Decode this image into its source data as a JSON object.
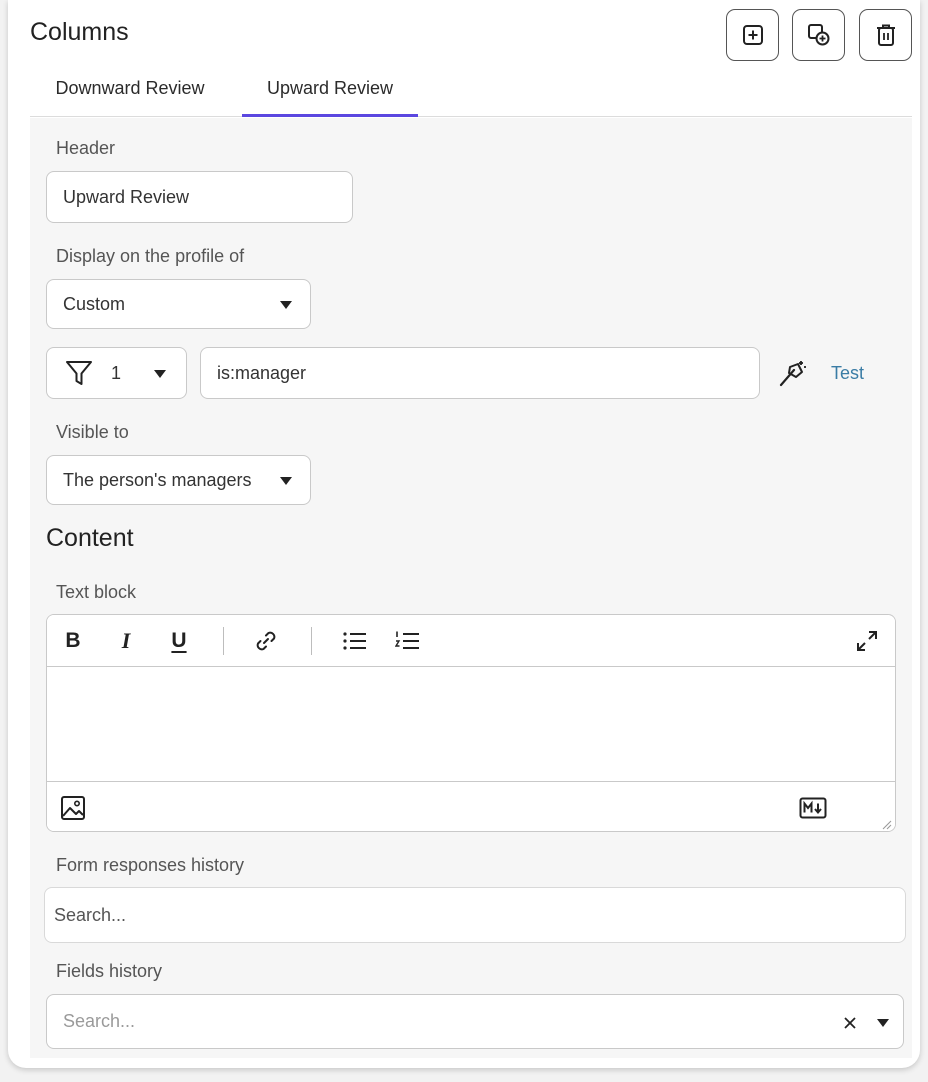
{
  "panel": {
    "title": "Columns",
    "actions": [
      {
        "name": "add-column",
        "icon": "plus-square-icon"
      },
      {
        "name": "duplicate-column",
        "icon": "copy-plus-icon"
      },
      {
        "name": "delete-column",
        "icon": "trash-icon"
      }
    ]
  },
  "tabs": [
    {
      "label": "Downward Review",
      "active": false
    },
    {
      "label": "Upward Review",
      "active": true
    }
  ],
  "header_field": {
    "label": "Header",
    "value": "Upward Review"
  },
  "display_on": {
    "label": "Display on the profile of",
    "value": "Custom"
  },
  "filter": {
    "count": "1",
    "query": "is:manager",
    "test_label": "Test",
    "icon": "filter-icon",
    "wand_icon": "magic-wand-icon"
  },
  "visible_to": {
    "label": "Visible to",
    "value": "The person's managers"
  },
  "content": {
    "title": "Content"
  },
  "text_block": {
    "label": "Text block",
    "toolbar": [
      "bold-icon",
      "italic-icon",
      "underline-icon",
      "link-icon",
      "bullet-list-icon",
      "numbered-list-icon",
      "expand-icon"
    ],
    "footer": [
      "image-icon",
      "markdown-icon"
    ]
  },
  "form_history": {
    "label": "Form responses history",
    "placeholder": "Search..."
  },
  "fields_history": {
    "label": "Fields history",
    "placeholder": "Search..."
  },
  "colors": {
    "accent": "#5b47e0",
    "link": "#3a7ca5",
    "border": "#c9c9c9"
  }
}
